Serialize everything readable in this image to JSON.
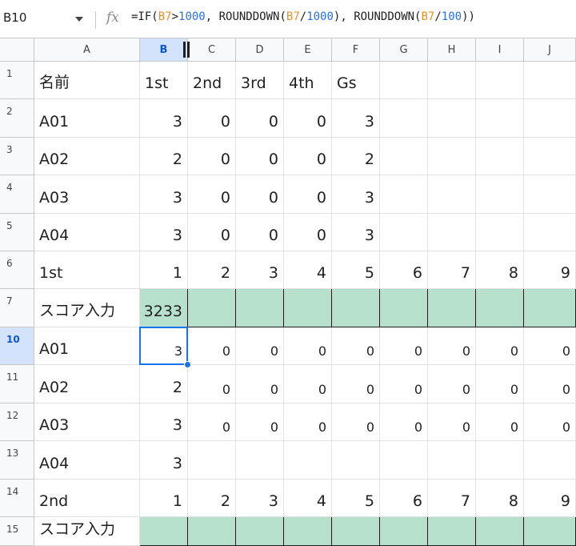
{
  "formula_bar": {
    "cell_ref": "B10",
    "fx_label": "fx",
    "formula_tokens": [
      {
        "t": "=IF(",
        "k": "plain"
      },
      {
        "t": "B7",
        "k": "ref"
      },
      {
        "t": ">",
        "k": "plain"
      },
      {
        "t": "1000",
        "k": "num"
      },
      {
        "t": ", ROUNDDOWN(",
        "k": "plain"
      },
      {
        "t": "B7",
        "k": "ref"
      },
      {
        "t": "/",
        "k": "plain"
      },
      {
        "t": "1000",
        "k": "num"
      },
      {
        "t": "), ROUNDDOWN(",
        "k": "plain"
      },
      {
        "t": "B7",
        "k": "ref"
      },
      {
        "t": "/",
        "k": "plain"
      },
      {
        "t": "100",
        "k": "num"
      },
      {
        "t": "))",
        "k": "plain"
      }
    ]
  },
  "columns": [
    "A",
    "B",
    "C",
    "D",
    "E",
    "F",
    "G",
    "H",
    "I",
    "J"
  ],
  "active_column": "B",
  "active_row": "10",
  "rows": [
    {
      "num": "1",
      "cells": [
        "名前",
        "1st",
        "2nd",
        "3rd",
        "4th",
        "Gs",
        "",
        "",
        "",
        ""
      ],
      "align": "text"
    },
    {
      "num": "2",
      "cells": [
        "A01",
        "3",
        "0",
        "0",
        "0",
        "3",
        "",
        "",
        "",
        ""
      ]
    },
    {
      "num": "3",
      "cells": [
        "A02",
        "2",
        "0",
        "0",
        "0",
        "2",
        "",
        "",
        "",
        ""
      ]
    },
    {
      "num": "4",
      "cells": [
        "A03",
        "3",
        "0",
        "0",
        "0",
        "3",
        "",
        "",
        "",
        ""
      ]
    },
    {
      "num": "5",
      "cells": [
        "A04",
        "3",
        "0",
        "0",
        "0",
        "3",
        "",
        "",
        "",
        ""
      ]
    },
    {
      "num": "6",
      "cells": [
        "1st",
        "1",
        "2",
        "3",
        "4",
        "5",
        "6",
        "7",
        "8",
        "9"
      ]
    },
    {
      "num": "7",
      "cells": [
        "スコア入力",
        "3233",
        "",
        "",
        "",
        "",
        "",
        "",
        "",
        ""
      ],
      "green": true
    },
    {
      "num": "10",
      "cells": [
        "A01",
        "3",
        "0",
        "0",
        "0",
        "0",
        "0",
        "0",
        "0",
        "0"
      ],
      "small": true
    },
    {
      "num": "11",
      "cells": [
        "A02",
        "2",
        "0",
        "0",
        "0",
        "0",
        "0",
        "0",
        "0",
        "0"
      ],
      "small": true
    },
    {
      "num": "12",
      "cells": [
        "A03",
        "3",
        "0",
        "0",
        "0",
        "0",
        "0",
        "0",
        "0",
        "0"
      ],
      "small": true
    },
    {
      "num": "13",
      "cells": [
        "A04",
        "3",
        "",
        "",
        "",
        "",
        "",
        "",
        "",
        ""
      ]
    },
    {
      "num": "14",
      "cells": [
        "2nd",
        "1",
        "2",
        "3",
        "4",
        "5",
        "6",
        "7",
        "8",
        "9"
      ]
    },
    {
      "num": "15",
      "cells": [
        "スコア入力",
        "",
        "",
        "",
        "",
        "",
        "",
        "",
        "",
        ""
      ],
      "green": true
    }
  ],
  "colors": {
    "selection": "#1a73e8",
    "input_fill": "#b7e1cd",
    "header_active": "#d3e3fd"
  }
}
